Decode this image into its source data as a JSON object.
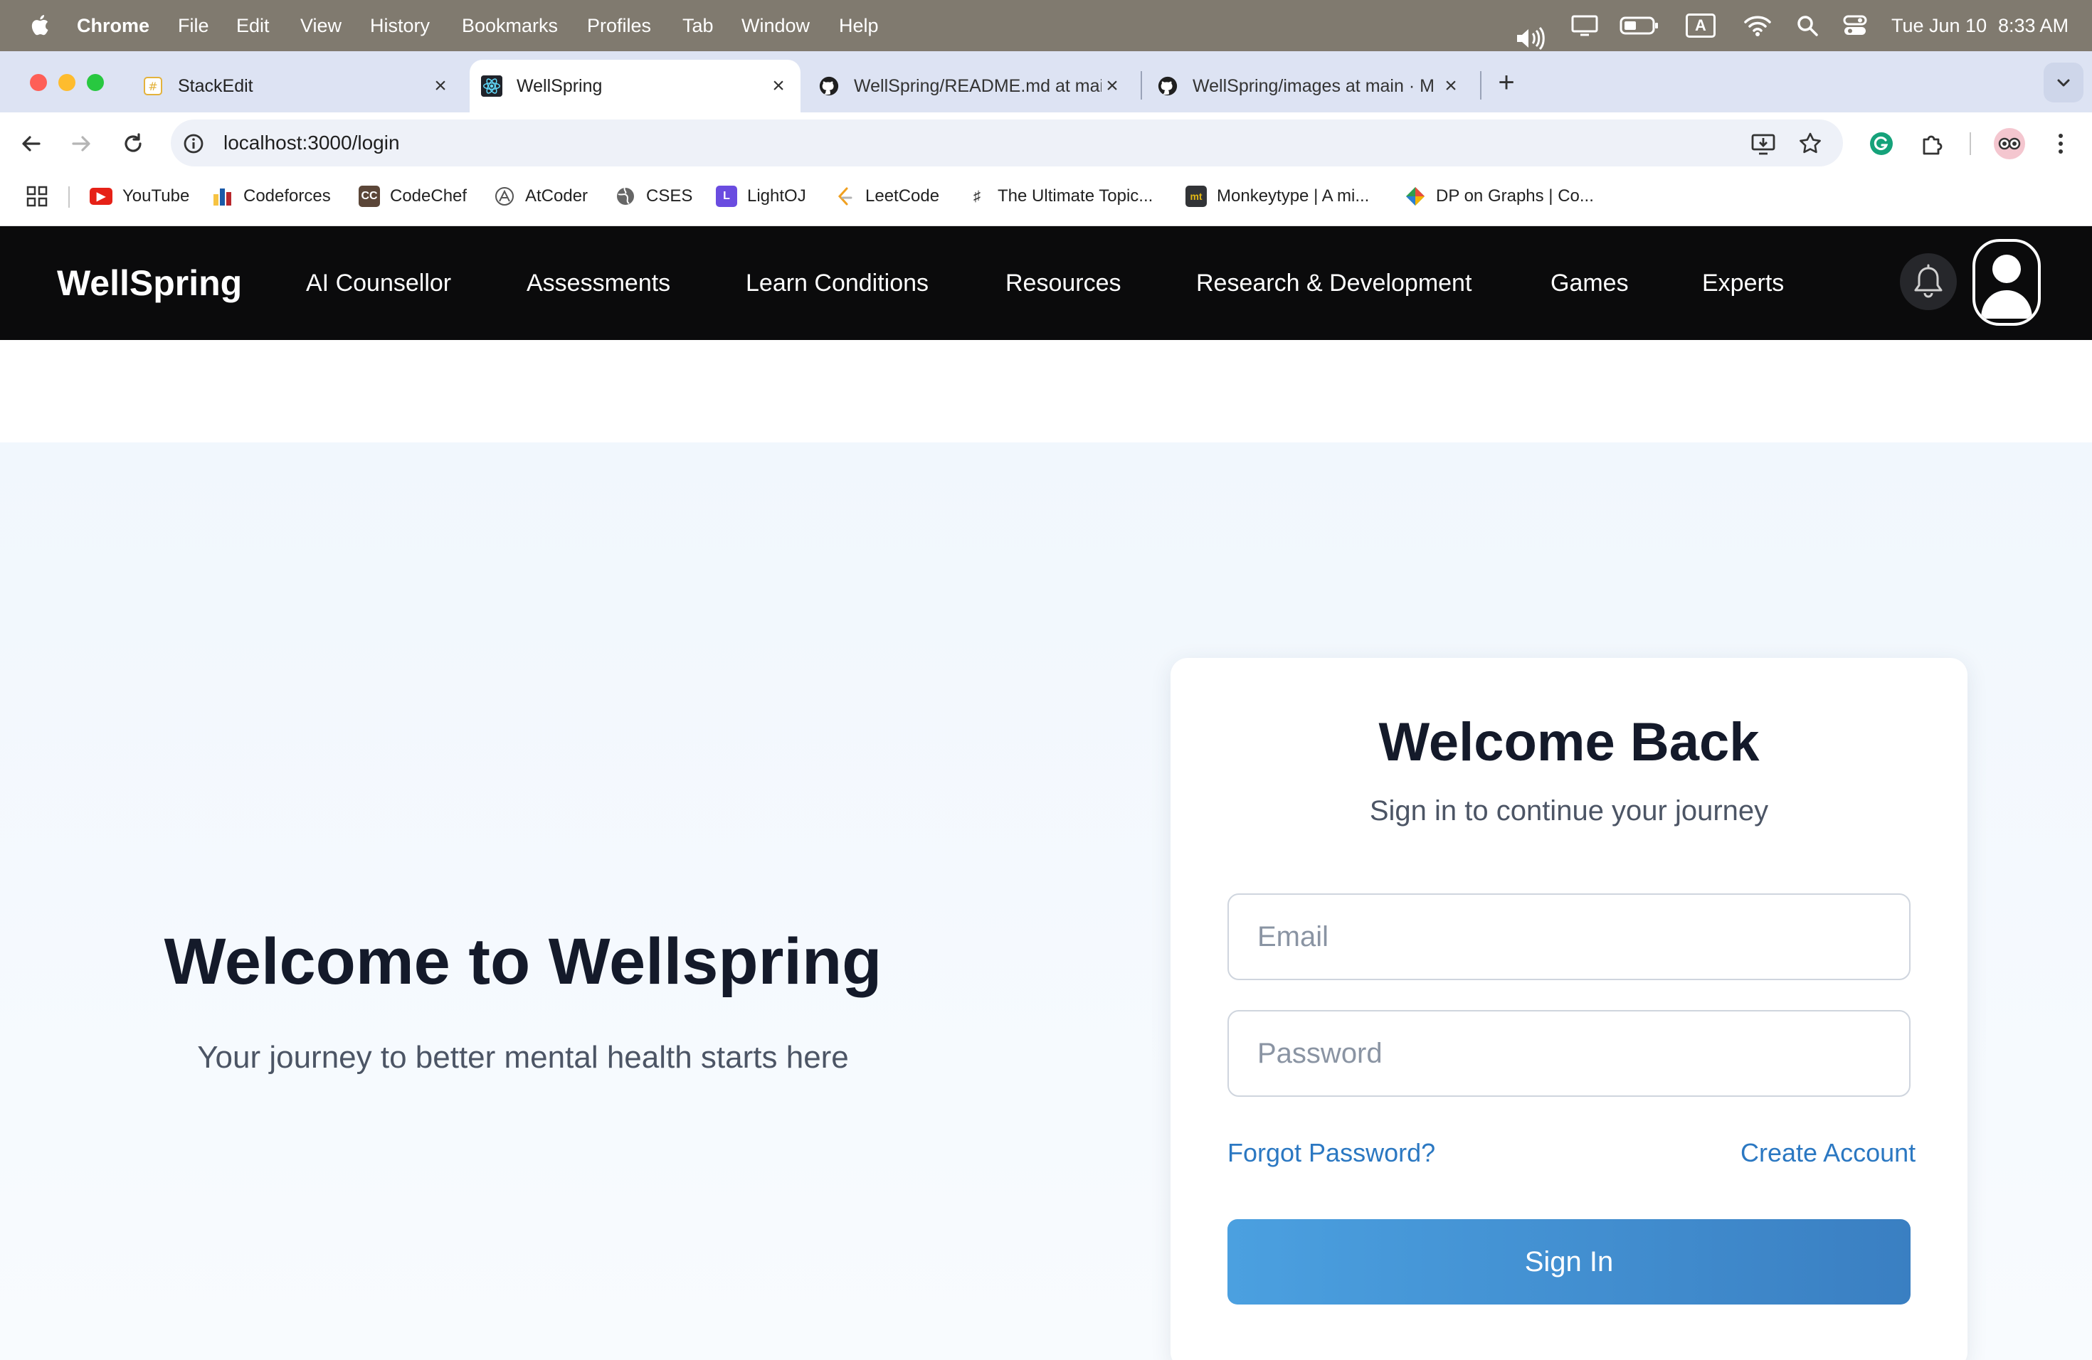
{
  "menubar": {
    "app": "Chrome",
    "items": [
      "File",
      "Edit",
      "View",
      "History",
      "Bookmarks",
      "Profiles",
      "Tab",
      "Window",
      "Help"
    ],
    "input_indicator": "A",
    "date": "Tue Jun 10",
    "time": "8:33 AM"
  },
  "tabs": [
    {
      "title": "StackEdit",
      "icon": "stackedit-icon"
    },
    {
      "title": "WellSpring",
      "icon": "react-icon"
    },
    {
      "title": "WellSpring/README.md at main",
      "icon": "github-icon"
    },
    {
      "title": "WellSpring/images at main · M",
      "icon": "github-icon"
    }
  ],
  "address": {
    "url": "localhost:3000/login"
  },
  "bookmarks": [
    {
      "label": "YouTube",
      "icon": "youtube-icon",
      "color": "#e62117"
    },
    {
      "label": "Codeforces",
      "icon": "codeforces-icon",
      "color": "#1a5aa8"
    },
    {
      "label": "CodeChef",
      "icon": "codechef-icon",
      "color": "#5b4638"
    },
    {
      "label": "AtCoder",
      "icon": "atcoder-icon",
      "color": "#555555"
    },
    {
      "label": "CSES",
      "icon": "globe-icon",
      "color": "#555555"
    },
    {
      "label": "LightOJ",
      "icon": "lightoj-icon",
      "color": "#6a4ce0"
    },
    {
      "label": "LeetCode",
      "icon": "leetcode-icon",
      "color": "#f0a020"
    },
    {
      "label": "The Ultimate Topic...",
      "icon": "music-icon",
      "color": "#333333"
    },
    {
      "label": "Monkeytype | A mi...",
      "icon": "monkeytype-icon",
      "color": "#323437"
    },
    {
      "label": "DP on Graphs | Co...",
      "icon": "codeforces-diamond-icon",
      "color": "#2e9e4f"
    }
  ],
  "navbar": {
    "brand": "WellSpring",
    "links": [
      "AI Counsellor",
      "Assessments",
      "Learn Conditions",
      "Resources",
      "Research & Development",
      "Games",
      "Experts"
    ]
  },
  "hero": {
    "title": "Welcome to Wellspring",
    "subtitle": "Your journey to better mental health starts here"
  },
  "login": {
    "title": "Welcome Back",
    "subtitle": "Sign in to continue your journey",
    "email_placeholder": "Email",
    "password_placeholder": "Password",
    "forgot": "Forgot Password?",
    "create": "Create Account",
    "submit": "Sign In"
  }
}
